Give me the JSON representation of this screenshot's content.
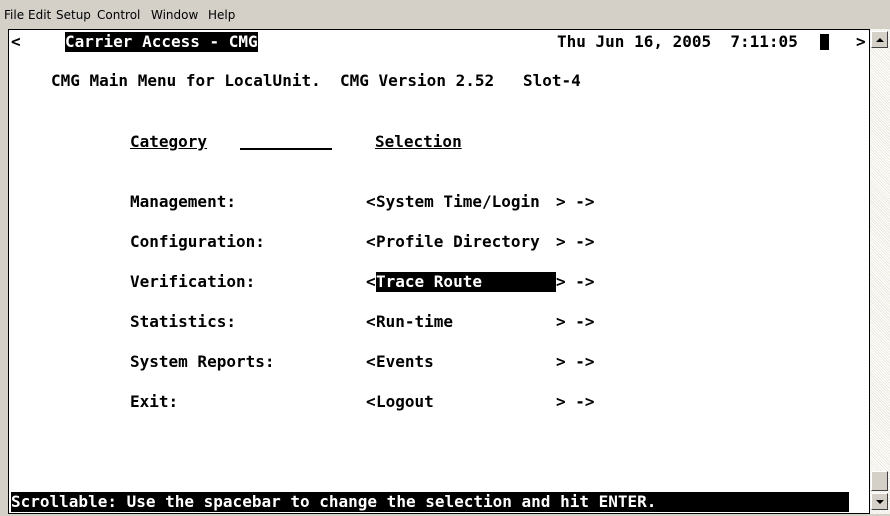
{
  "menu": [
    "File",
    "Edit",
    "Setup",
    "Control",
    "Window",
    "Help"
  ],
  "header": {
    "left_marker": "<",
    "title": "Carrier Access - CMG",
    "datetime": "Thu Jun 16, 2005  7:11:05",
    "right_marker": ">"
  },
  "subtitle": "CMG Main Menu for LocalUnit.  CMG Version 2.52   Slot-4",
  "columns": {
    "category": "Category",
    "selection": "Selection"
  },
  "rows": [
    {
      "category": "Management:",
      "sel_open": "<",
      "selection": "System Time/Login",
      "sel_close": "> ->"
    },
    {
      "category": "Configuration:",
      "sel_open": "<",
      "selection": "Profile Directory",
      "sel_close": "> ->"
    },
    {
      "category": "Verification:",
      "sel_open": "<",
      "selection": "Trace Route",
      "sel_close": "> ->"
    },
    {
      "category": "Statistics:",
      "sel_open": "<",
      "selection": "Run-time",
      "sel_close": "> ->"
    },
    {
      "category": "System Reports:",
      "sel_open": "<",
      "selection": "Events",
      "sel_close": "> ->"
    },
    {
      "category": "Exit:",
      "sel_open": "<",
      "selection": "Logout",
      "sel_close": "> ->"
    }
  ],
  "status_line": "Scrollable: Use the spacebar to change the selection and hit ENTER.",
  "colors": {
    "background": "#ffffff",
    "foreground": "#000000",
    "chrome": "#d4d0c8"
  }
}
